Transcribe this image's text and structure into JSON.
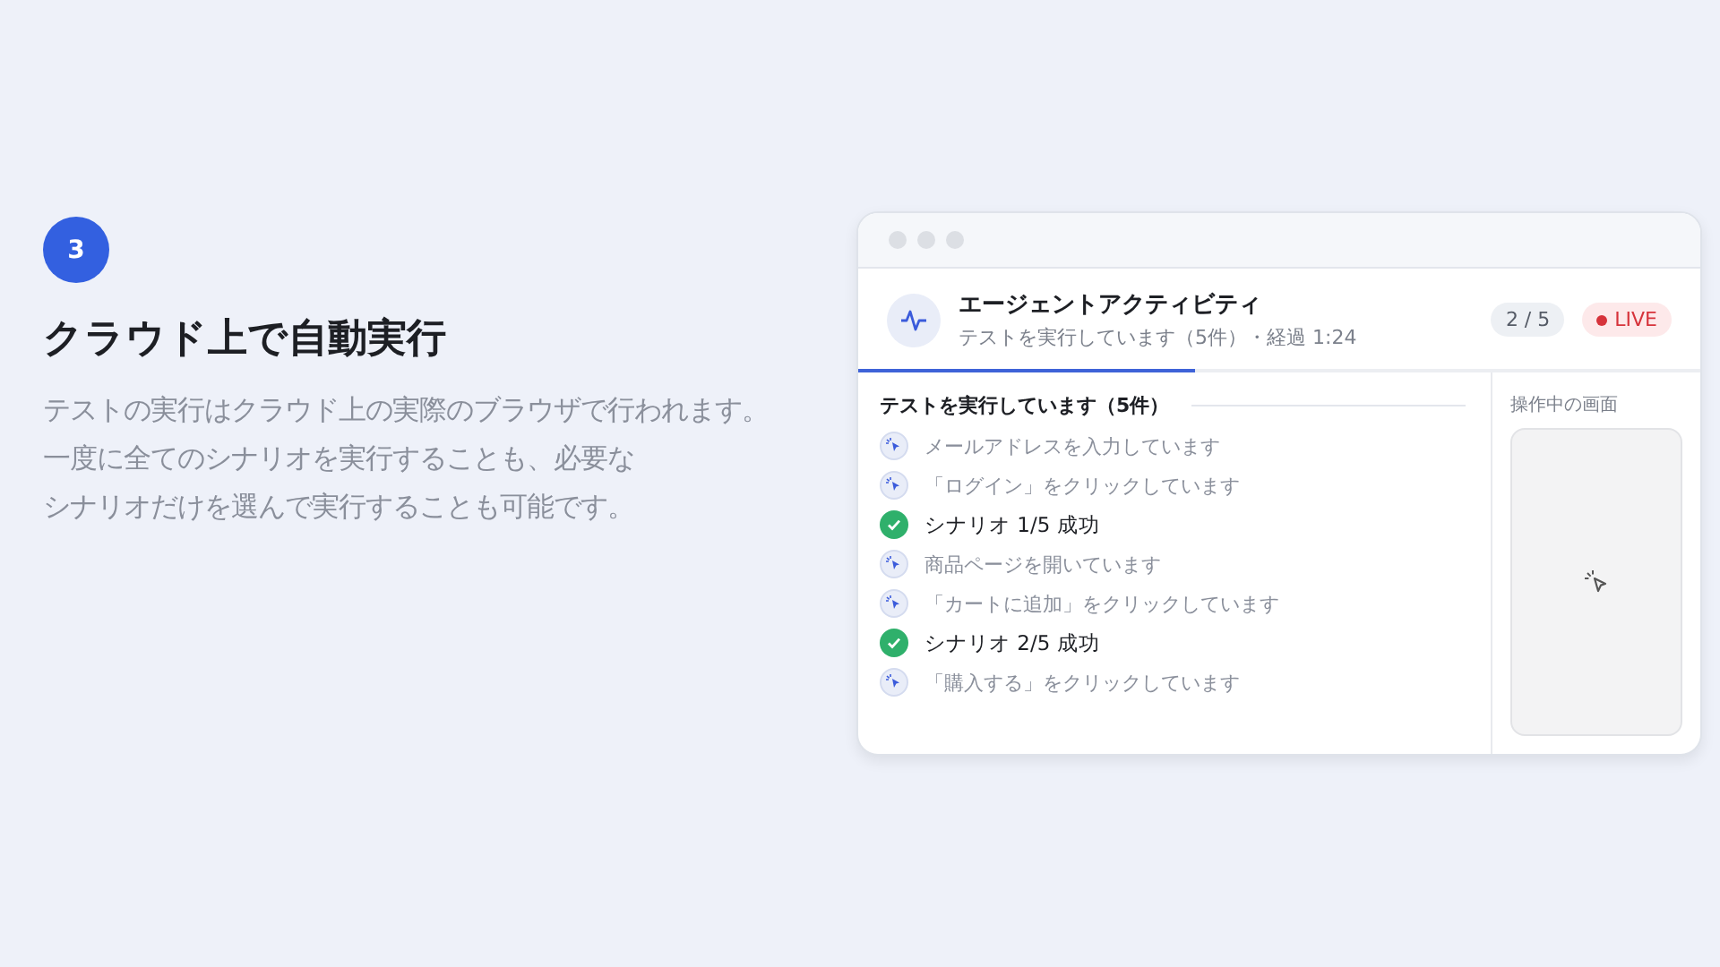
{
  "step": {
    "number": "3",
    "title": "クラウド上で自動実行",
    "description_lines": [
      "テストの実行はクラウド上の実際のブラウザで行われます。",
      "一度に全てのシナリオを実行することも、必要な",
      "シナリオだけを選んで実行することも可能です。"
    ]
  },
  "window": {
    "header": {
      "title": "エージェントアクティビティ",
      "subtitle": "テストを実行しています（5件）・経過 1:24",
      "counter": "2 / 5",
      "live": "LIVE"
    },
    "progress": {
      "level": 0.4
    },
    "activity": {
      "heading": "テストを実行しています（5件）",
      "items": [
        {
          "kind": "action",
          "text": "メールアドレスを入力しています"
        },
        {
          "kind": "action",
          "text": "「ログイン」をクリックしています"
        },
        {
          "kind": "success",
          "text": "シナリオ 1/5 成功"
        },
        {
          "kind": "action",
          "text": "商品ページを開いています"
        },
        {
          "kind": "action",
          "text": "「カートに追加」をクリックしています"
        },
        {
          "kind": "success",
          "text": "シナリオ 2/5 成功"
        },
        {
          "kind": "action",
          "text": "「購入する」をクリックしています"
        }
      ]
    },
    "screen": {
      "label": "操作中の画面"
    }
  }
}
